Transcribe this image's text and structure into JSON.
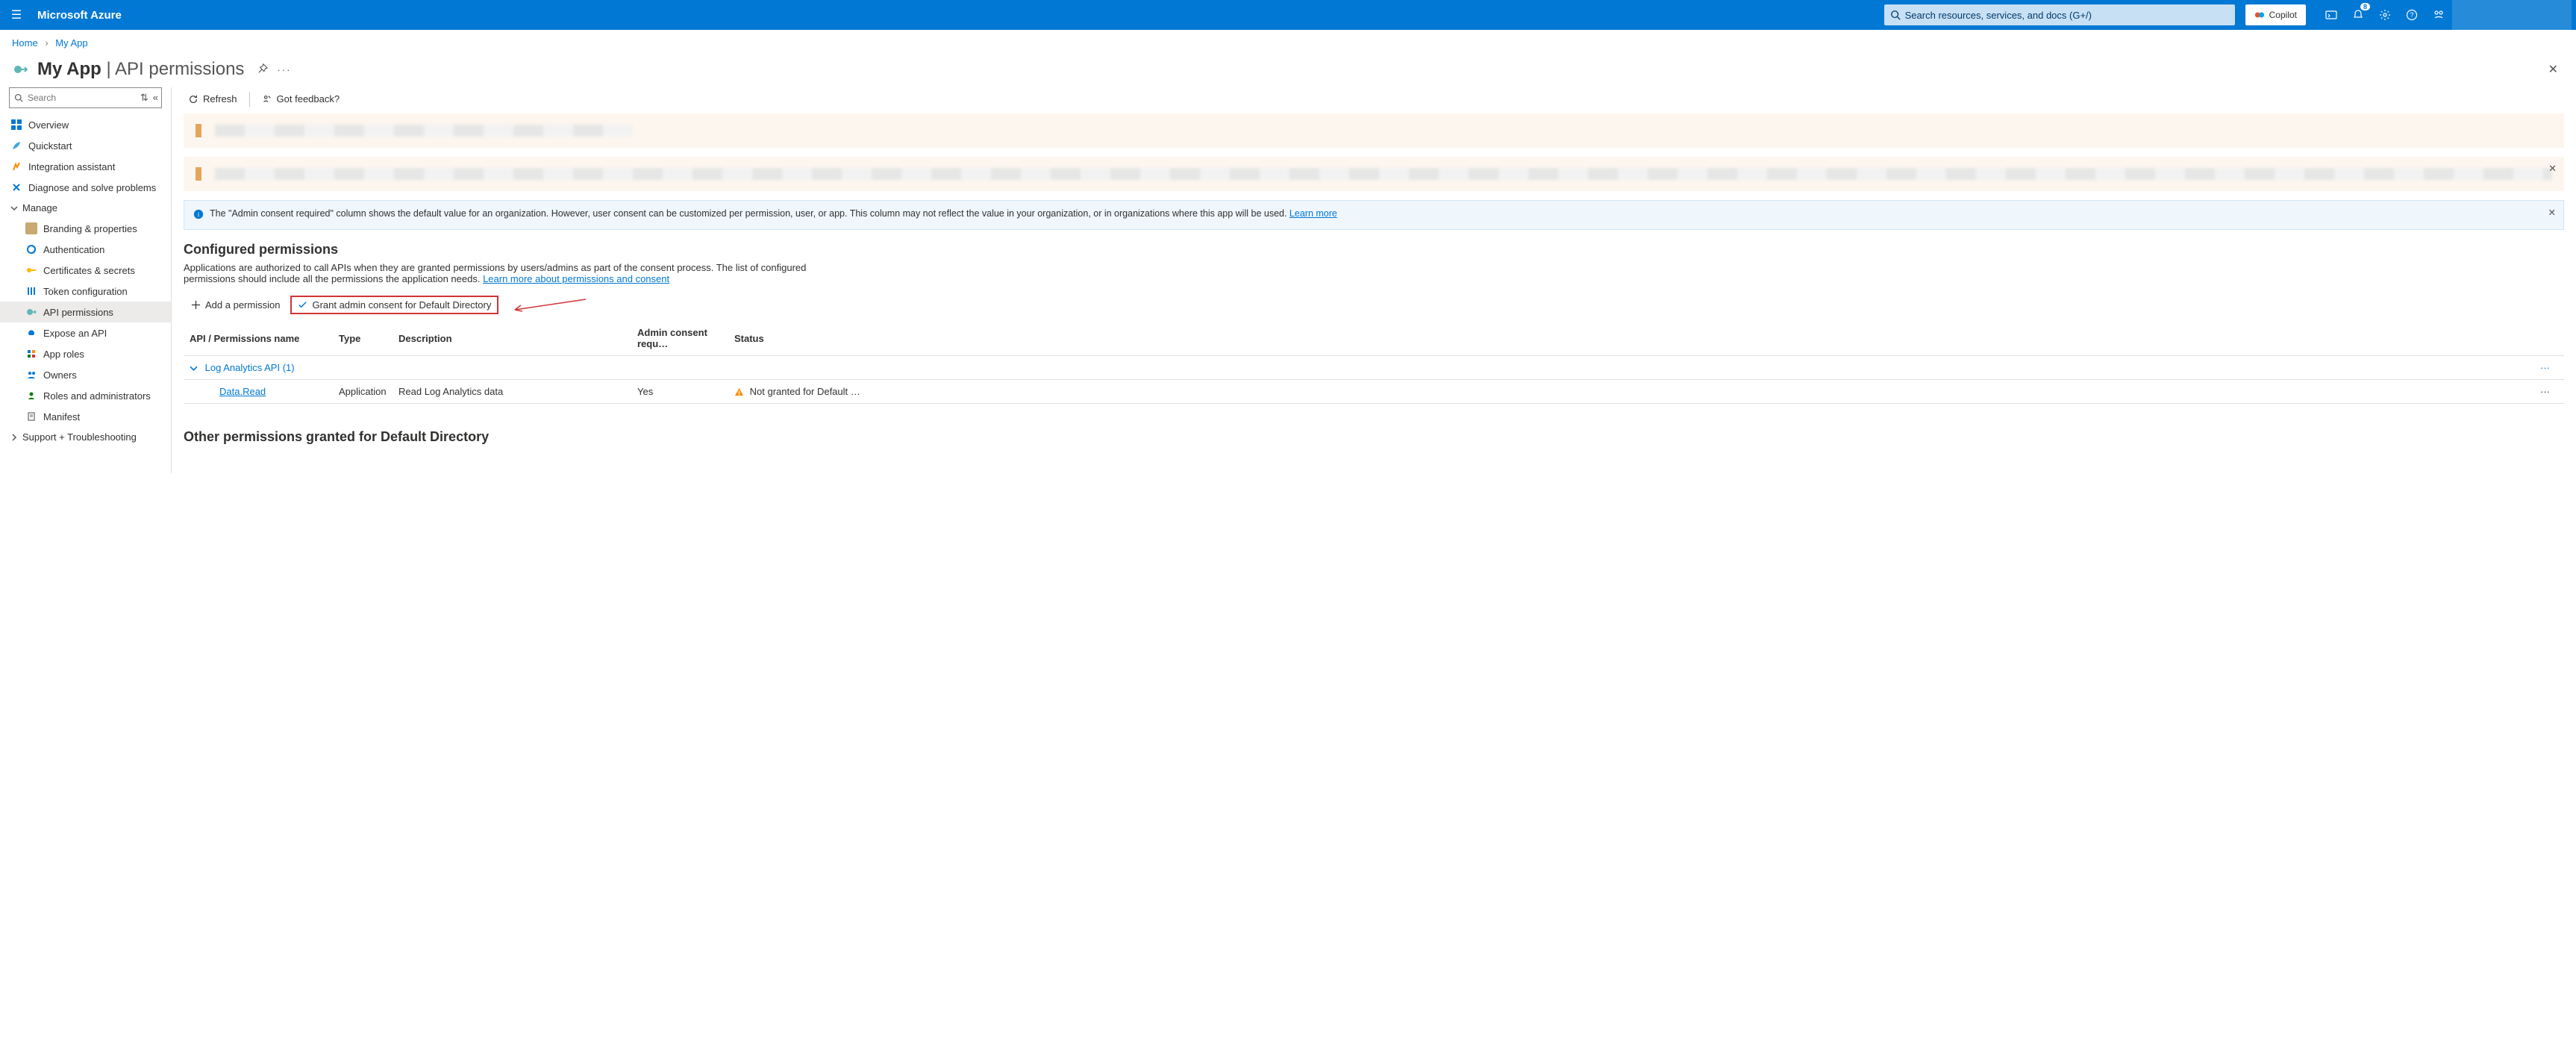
{
  "top": {
    "brand": "Microsoft Azure",
    "search_placeholder": "Search resources, services, and docs (G+/)",
    "copilot_label": "Copilot",
    "notification_count": "8"
  },
  "breadcrumb": {
    "home": "Home",
    "app": "My App"
  },
  "title": {
    "app": "My App",
    "page": "API permissions"
  },
  "left_search_placeholder": "Search",
  "nav": {
    "overview": "Overview",
    "quickstart": "Quickstart",
    "integration": "Integration assistant",
    "diagnose": "Diagnose and solve problems",
    "manage": "Manage",
    "branding": "Branding & properties",
    "auth": "Authentication",
    "certs": "Certificates & secrets",
    "token": "Token configuration",
    "api_perm": "API permissions",
    "expose": "Expose an API",
    "approles": "App roles",
    "owners": "Owners",
    "roles": "Roles and administrators",
    "manifest": "Manifest",
    "support": "Support + Troubleshooting"
  },
  "toolbar": {
    "refresh": "Refresh",
    "feedback": "Got feedback?"
  },
  "info": {
    "text": "The \"Admin consent required\" column shows the default value for an organization. However, user consent can be customized per permission, user, or app. This column may not reflect the value in your organization, or in organizations where this app will be used. ",
    "learn_more": "Learn more"
  },
  "configured": {
    "heading": "Configured permissions",
    "desc_a": "Applications are authorized to call APIs when they are granted permissions by users/admins as part of the consent process. The list of configured permissions should include all the permissions the application needs. ",
    "desc_link": "Learn more about permissions and consent"
  },
  "actions": {
    "add": "Add a permission",
    "grant": "Grant admin consent for Default Directory"
  },
  "table": {
    "cols": {
      "api": "API / Permissions name",
      "type": "Type",
      "desc": "Description",
      "admin": "Admin consent requ…",
      "status": "Status"
    },
    "group": "Log Analytics API (1)",
    "row": {
      "name": "Data.Read",
      "type": "Application",
      "desc": "Read Log Analytics data",
      "admin": "Yes",
      "status": "Not granted for Default …"
    }
  },
  "other_heading": "Other permissions granted for Default Directory"
}
